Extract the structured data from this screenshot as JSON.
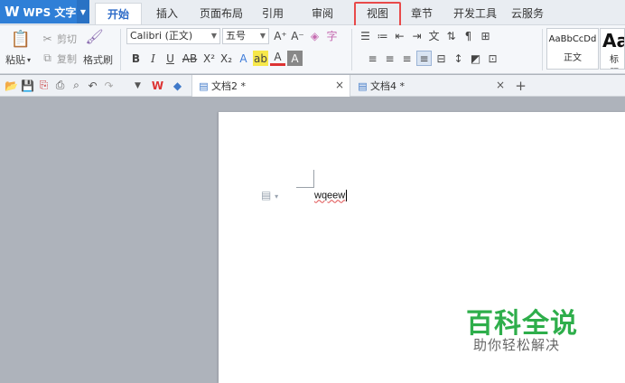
{
  "app": {
    "name": "WPS 文字",
    "logo": "W"
  },
  "menu": {
    "tabs": [
      "开始",
      "插入",
      "页面布局",
      "引用",
      "审阅",
      "视图",
      "章节",
      "开发工具",
      "云服务"
    ],
    "active": "开始",
    "highlighted": "视图"
  },
  "ribbon": {
    "paste": "粘贴",
    "cut": "剪切",
    "copy": "复制",
    "format_painter": "格式刷",
    "font_name": "Calibri (正文)",
    "font_size": "五号",
    "styles": [
      {
        "preview": "AaBbCcDd",
        "label": "正文"
      },
      {
        "preview": "Aa",
        "label": "标题"
      }
    ]
  },
  "doc_tabs": [
    {
      "label": "文档2 *",
      "active": true
    },
    {
      "label": "文档4 *",
      "active": false
    }
  ],
  "new_tab": "+",
  "document": {
    "text": "wqeew"
  },
  "watermark": {
    "title": "百科全说",
    "subtitle": "助你轻松解决"
  },
  "colors": {
    "accent": "#2f7fd7",
    "highlight_border": "#e84a4a",
    "watermark_green": "#2eae4b"
  }
}
